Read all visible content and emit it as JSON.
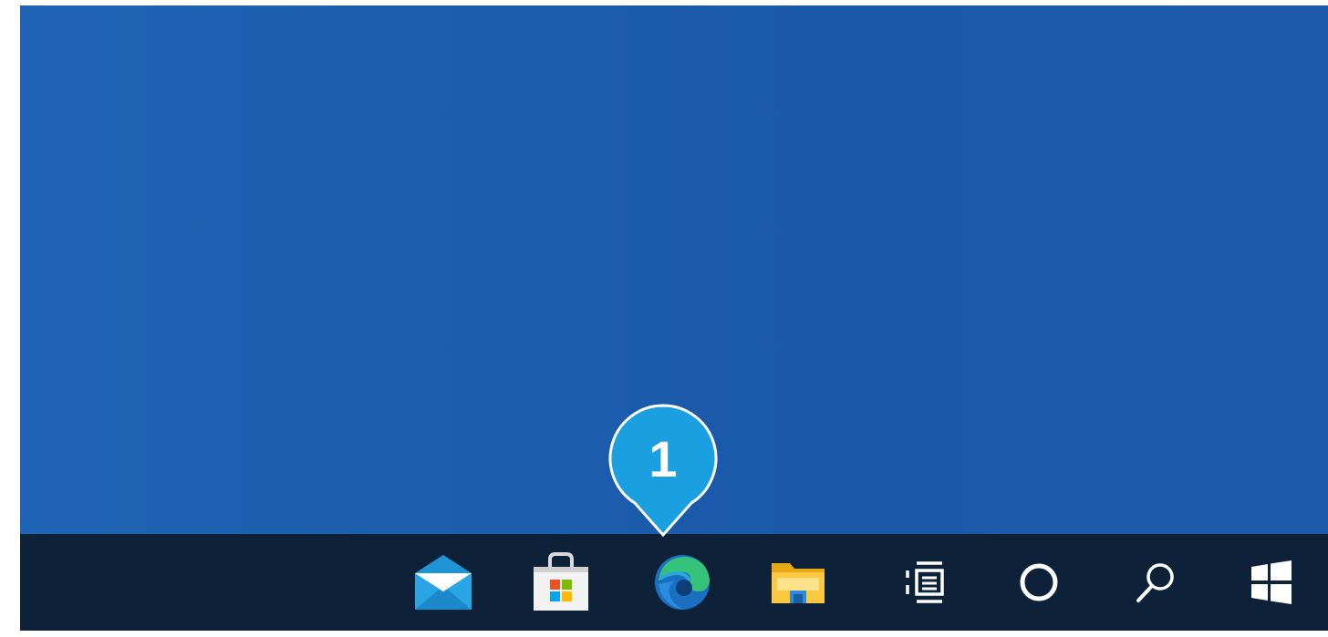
{
  "callout": {
    "number": "1",
    "fill": "#1a9fe0",
    "border": "#ffffff"
  },
  "taskbar": {
    "background": "#0d2238",
    "buttons": [
      {
        "id": "mail",
        "icon": "mail-icon"
      },
      {
        "id": "store",
        "icon": "store-icon"
      },
      {
        "id": "edge",
        "icon": "edge-icon"
      },
      {
        "id": "file-explorer",
        "icon": "folder-icon"
      },
      {
        "id": "task-view",
        "icon": "task-view-icon"
      },
      {
        "id": "cortana",
        "icon": "cortana-icon"
      },
      {
        "id": "search",
        "icon": "search-icon"
      },
      {
        "id": "start",
        "icon": "windows-icon"
      }
    ]
  },
  "desktop": {
    "background": "#1c5eae"
  }
}
